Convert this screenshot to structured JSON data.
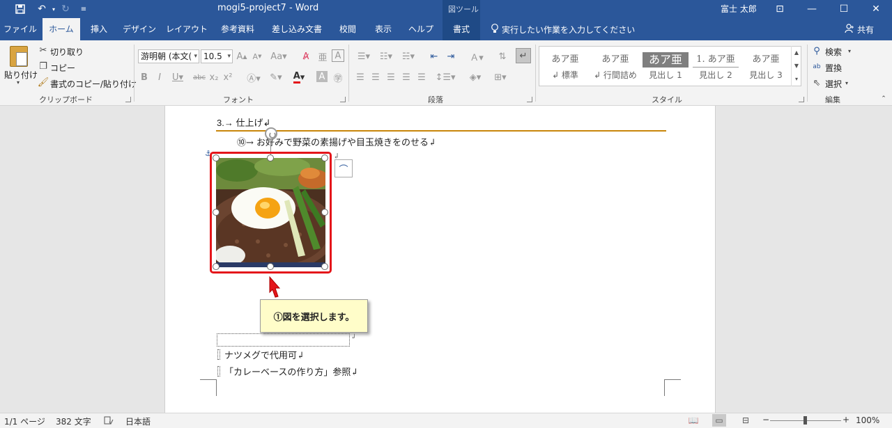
{
  "window": {
    "title": "mogi5-project7  -  Word",
    "contextual_group": "図ツール",
    "user": "富士 太郎",
    "quick_access": {
      "save_icon": "save-icon",
      "undo_icon": "undo-icon",
      "redo_icon": "redo-icon",
      "customize_icon": "customize-qat-icon"
    },
    "controls": {
      "ribbon_display": "⊡",
      "minimize": "—",
      "maximize": "☐",
      "close": "✕"
    }
  },
  "tabs": [
    {
      "label": "ファイル"
    },
    {
      "label": "ホーム",
      "active": true
    },
    {
      "label": "挿入"
    },
    {
      "label": "デザイン"
    },
    {
      "label": "レイアウト"
    },
    {
      "label": "参考資料"
    },
    {
      "label": "差し込み文書"
    },
    {
      "label": "校閲"
    },
    {
      "label": "表示"
    },
    {
      "label": "ヘルプ"
    },
    {
      "label": "書式",
      "contextual": true
    }
  ],
  "tell_me": "実行したい作業を入力してください",
  "share": "共有",
  "ribbon": {
    "clipboard": {
      "paste": "貼り付け",
      "cut": "切り取り",
      "copy": "コピー",
      "format_painter": "書式のコピー/貼り付け",
      "group_label": "クリップボード"
    },
    "font": {
      "font_name": "游明朝 (本文(",
      "font_size": "10.5",
      "group_label": "フォント",
      "font_color": "#e4151a"
    },
    "paragraph": {
      "group_label": "段落"
    },
    "styles": {
      "group_label": "スタイル",
      "items": [
        {
          "sample": "あア亜",
          "name": "↲ 標準"
        },
        {
          "sample": "あア亜",
          "name": "↲ 行間詰め"
        },
        {
          "sample": "あア亜",
          "name": "見出し 1"
        },
        {
          "sample": "1. あア亜",
          "name": "見出し 2"
        },
        {
          "sample": "あア亜",
          "name": "見出し 3"
        }
      ]
    },
    "editing": {
      "find": "検索",
      "replace": "置換",
      "select": "選択",
      "group_label": "編集"
    }
  },
  "document": {
    "heading": "3.→ 仕上げ↲",
    "step10": "⑩→ お好みで野菜の素揚げや目玉焼きをのせる↲",
    "image_pilcrow": "↲",
    "callout": "①図を選択します。",
    "footnote_sep_mark": "↲",
    "footnote1": "ナツメグで代用可↲",
    "footnote2": "「カレーベースの作り方」参照↲",
    "heading_rule_color": "#c8860a",
    "selection_color": "#e4151a"
  },
  "status": {
    "page": "1/1 ページ",
    "words": "382 文字",
    "language": "日本語",
    "zoom": "100%",
    "zoom_level": 1.0
  }
}
